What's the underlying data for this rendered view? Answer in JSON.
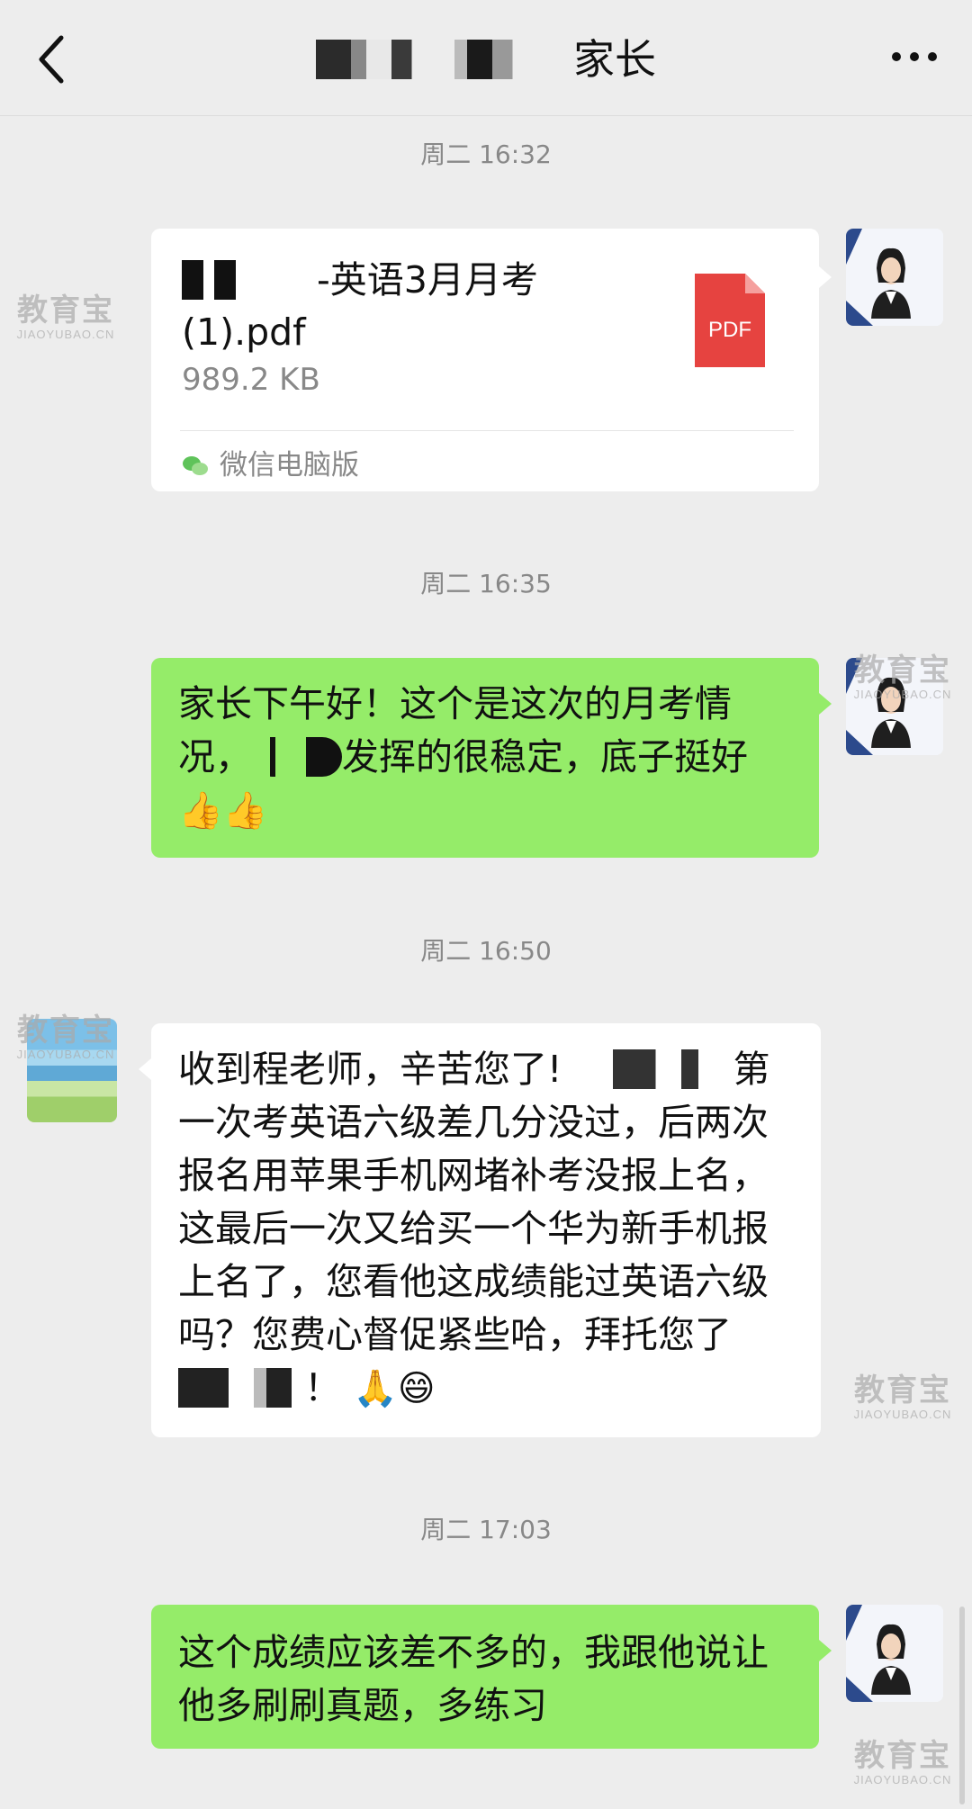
{
  "header": {
    "title": "家长",
    "back_icon": "chevron-left-icon",
    "more_icon": "more-dots-icon"
  },
  "messages": [
    {
      "type": "time",
      "text": "周二 16:32"
    },
    {
      "type": "file",
      "sender": "teacher",
      "file_name": "-英语3月月考(1).pdf",
      "file_size": "989.2 KB",
      "file_icon_label": "PDF",
      "source": "微信电脑版"
    },
    {
      "type": "time",
      "text": "周二 16:35"
    },
    {
      "type": "text",
      "sender": "teacher",
      "part1": "家长下午好！这个是这次的月考情况，",
      "part2": "发挥的很稳定，底子挺好",
      "emoji": "👍👍"
    },
    {
      "type": "time",
      "text": "周二 16:50"
    },
    {
      "type": "text",
      "sender": "parent",
      "part1": "收到程老师，辛苦您了!",
      "part2": "第一次考英语六级差几分没过，后两次报名用苹果手机网堵补考没报上名，这最后一次又给买一个华为新手机报上名了，您看他这成绩能过英语六级吗？您费心督促紧些哈，拜托您了",
      "part3": "！",
      "emoji": "🙏😄"
    },
    {
      "type": "time",
      "text": "周二 17:03"
    },
    {
      "type": "text",
      "sender": "teacher",
      "part1": "这个成绩应该差不多的，我跟他说让他多刷刷真题，多练习"
    }
  ],
  "watermark": {
    "big": "教育宝",
    "small": "JIAOYUBAO.CN"
  },
  "colors": {
    "background": "#ededed",
    "green_bubble": "#95ec69",
    "white_bubble": "#ffffff",
    "pdf_red": "#e64340",
    "time_text": "#888888"
  }
}
